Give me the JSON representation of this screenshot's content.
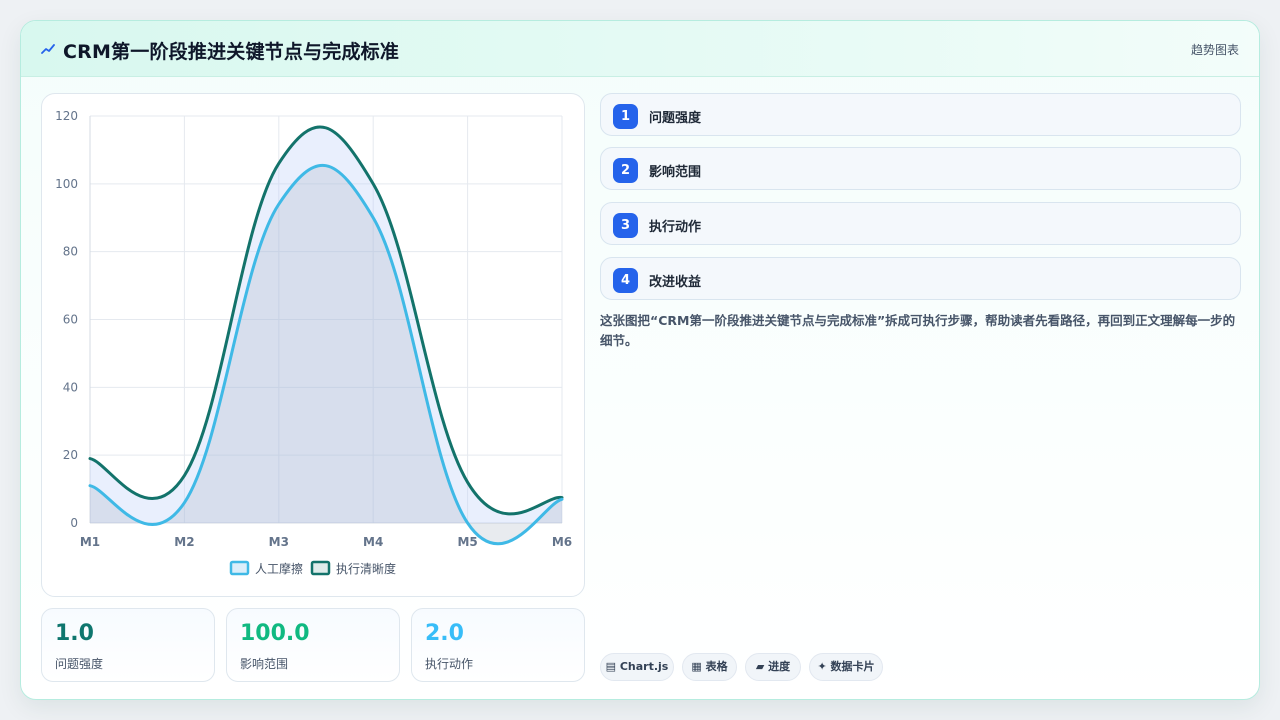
{
  "header": {
    "title": "CRM第一阶段推进关键节点与完成标准",
    "tag": "趋势图表",
    "icon": "trend-icon"
  },
  "chart_data": {
    "type": "area",
    "categories": [
      "M1",
      "M2",
      "M3",
      "M4",
      "M5",
      "M6"
    ],
    "yticks": [
      0,
      20,
      40,
      60,
      80,
      100,
      120
    ],
    "ylim": [
      0,
      120
    ],
    "legend_position": "bottom",
    "grid": true,
    "series": [
      {
        "name": "人工摩擦",
        "values": [
          11,
          6,
          94,
          90,
          0,
          7
        ],
        "color": "#3fb9e6"
      },
      {
        "name": "执行清晰度",
        "values": [
          19,
          14,
          106,
          100,
          12,
          7.5
        ],
        "color": "#13736b"
      }
    ]
  },
  "stats": [
    {
      "value": "1.0",
      "label": "问题强度",
      "color": "#0f766e"
    },
    {
      "value": "100.0",
      "label": "影响范围",
      "color": "#10b981"
    },
    {
      "value": "2.0",
      "label": "执行动作",
      "color": "#38bdf8"
    }
  ],
  "steps": [
    {
      "num": "1",
      "label": "问题强度"
    },
    {
      "num": "2",
      "label": "影响范围"
    },
    {
      "num": "3",
      "label": "执行动作"
    },
    {
      "num": "4",
      "label": "改进收益"
    }
  ],
  "description": "这张图把“CRM第一阶段推进关键节点与完成标准”拆成可执行步骤，帮助读者先看路径，再回到正文理解每一步的细节。",
  "tags": [
    "▤ Chart.js",
    "▦ 表格",
    "▰ 进度",
    "✦ 数据卡片"
  ]
}
